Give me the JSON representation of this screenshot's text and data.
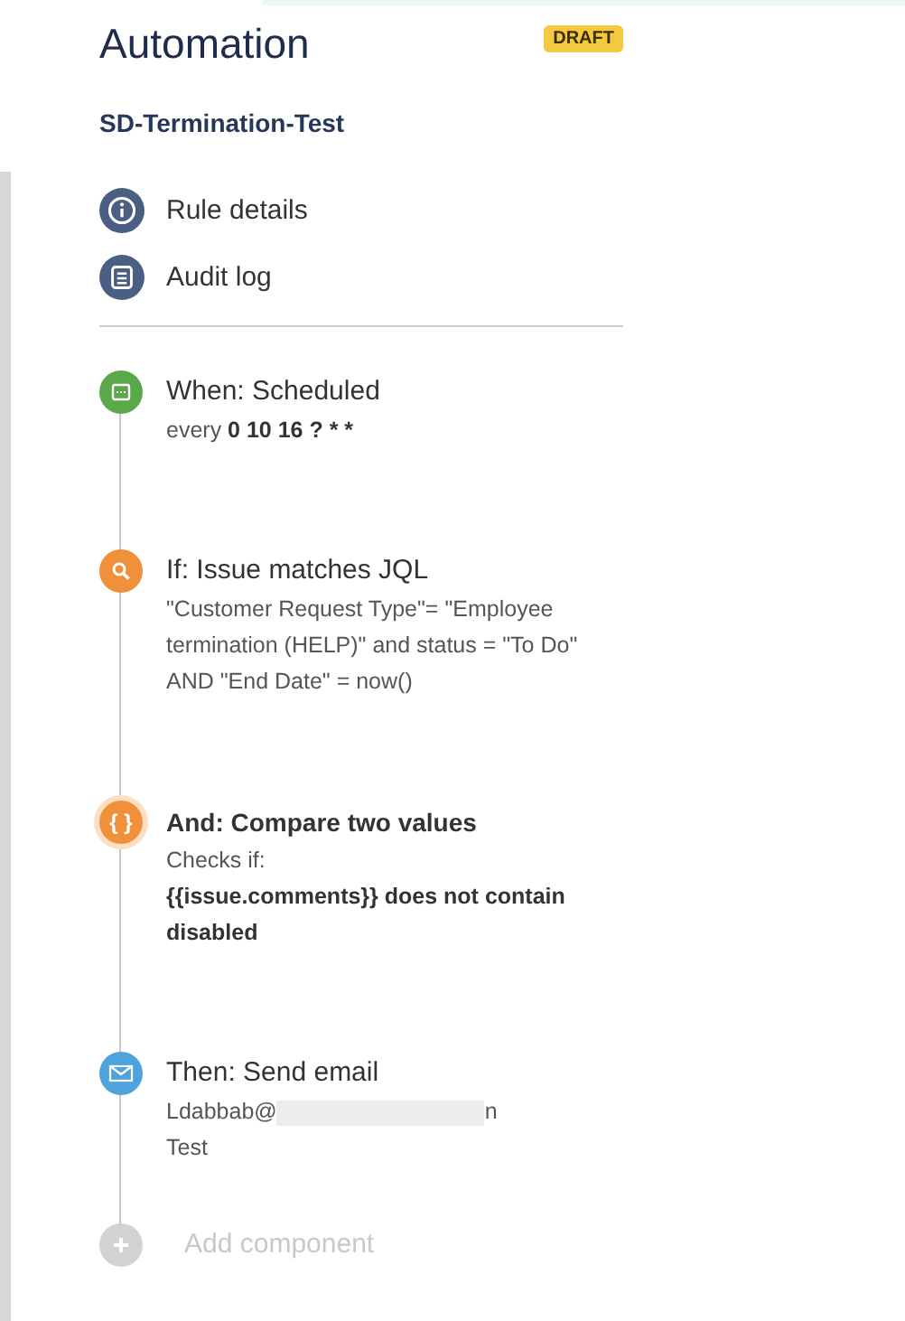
{
  "header": {
    "title": "Automation",
    "badge": "DRAFT",
    "rule_name": "SD-Termination-Test"
  },
  "menu": [
    {
      "kind": "info",
      "label": "Rule details"
    },
    {
      "kind": "log",
      "label": "Audit log"
    }
  ],
  "steps": [
    {
      "kind": "calendar",
      "color": "#5aa84a",
      "selected": false,
      "title": "When: Scheduled",
      "lines": [
        [
          {
            "text": "every "
          },
          {
            "text": "0 10 16 ? * *",
            "bold": true
          }
        ]
      ]
    },
    {
      "kind": "search",
      "color": "#f0903a",
      "selected": false,
      "title": "If: Issue matches JQL",
      "lines": [
        [
          {
            "text": "\"Customer Request Type\"= \"Employee termination (HELP)\" and status = \"To Do\" AND \"End Date\" = now()"
          }
        ]
      ]
    },
    {
      "kind": "braces",
      "icon_text": "{ }",
      "color": "#f0903a",
      "selected": true,
      "title": "And: Compare two values",
      "lines": [
        [
          {
            "text": "Checks if:"
          }
        ],
        [
          {
            "text": "{{issue.comments}} does not contain disabled",
            "bold": true
          }
        ]
      ]
    },
    {
      "kind": "mail",
      "color": "#4fa3dc",
      "selected": false,
      "title": "Then: Send email",
      "lines": [
        [
          {
            "text": "Ldabbab@"
          },
          {
            "redacted": true
          },
          {
            "text": "n"
          }
        ],
        [
          {
            "text": "Test"
          }
        ]
      ]
    }
  ],
  "add": {
    "label": "Add component",
    "disabled": true
  }
}
